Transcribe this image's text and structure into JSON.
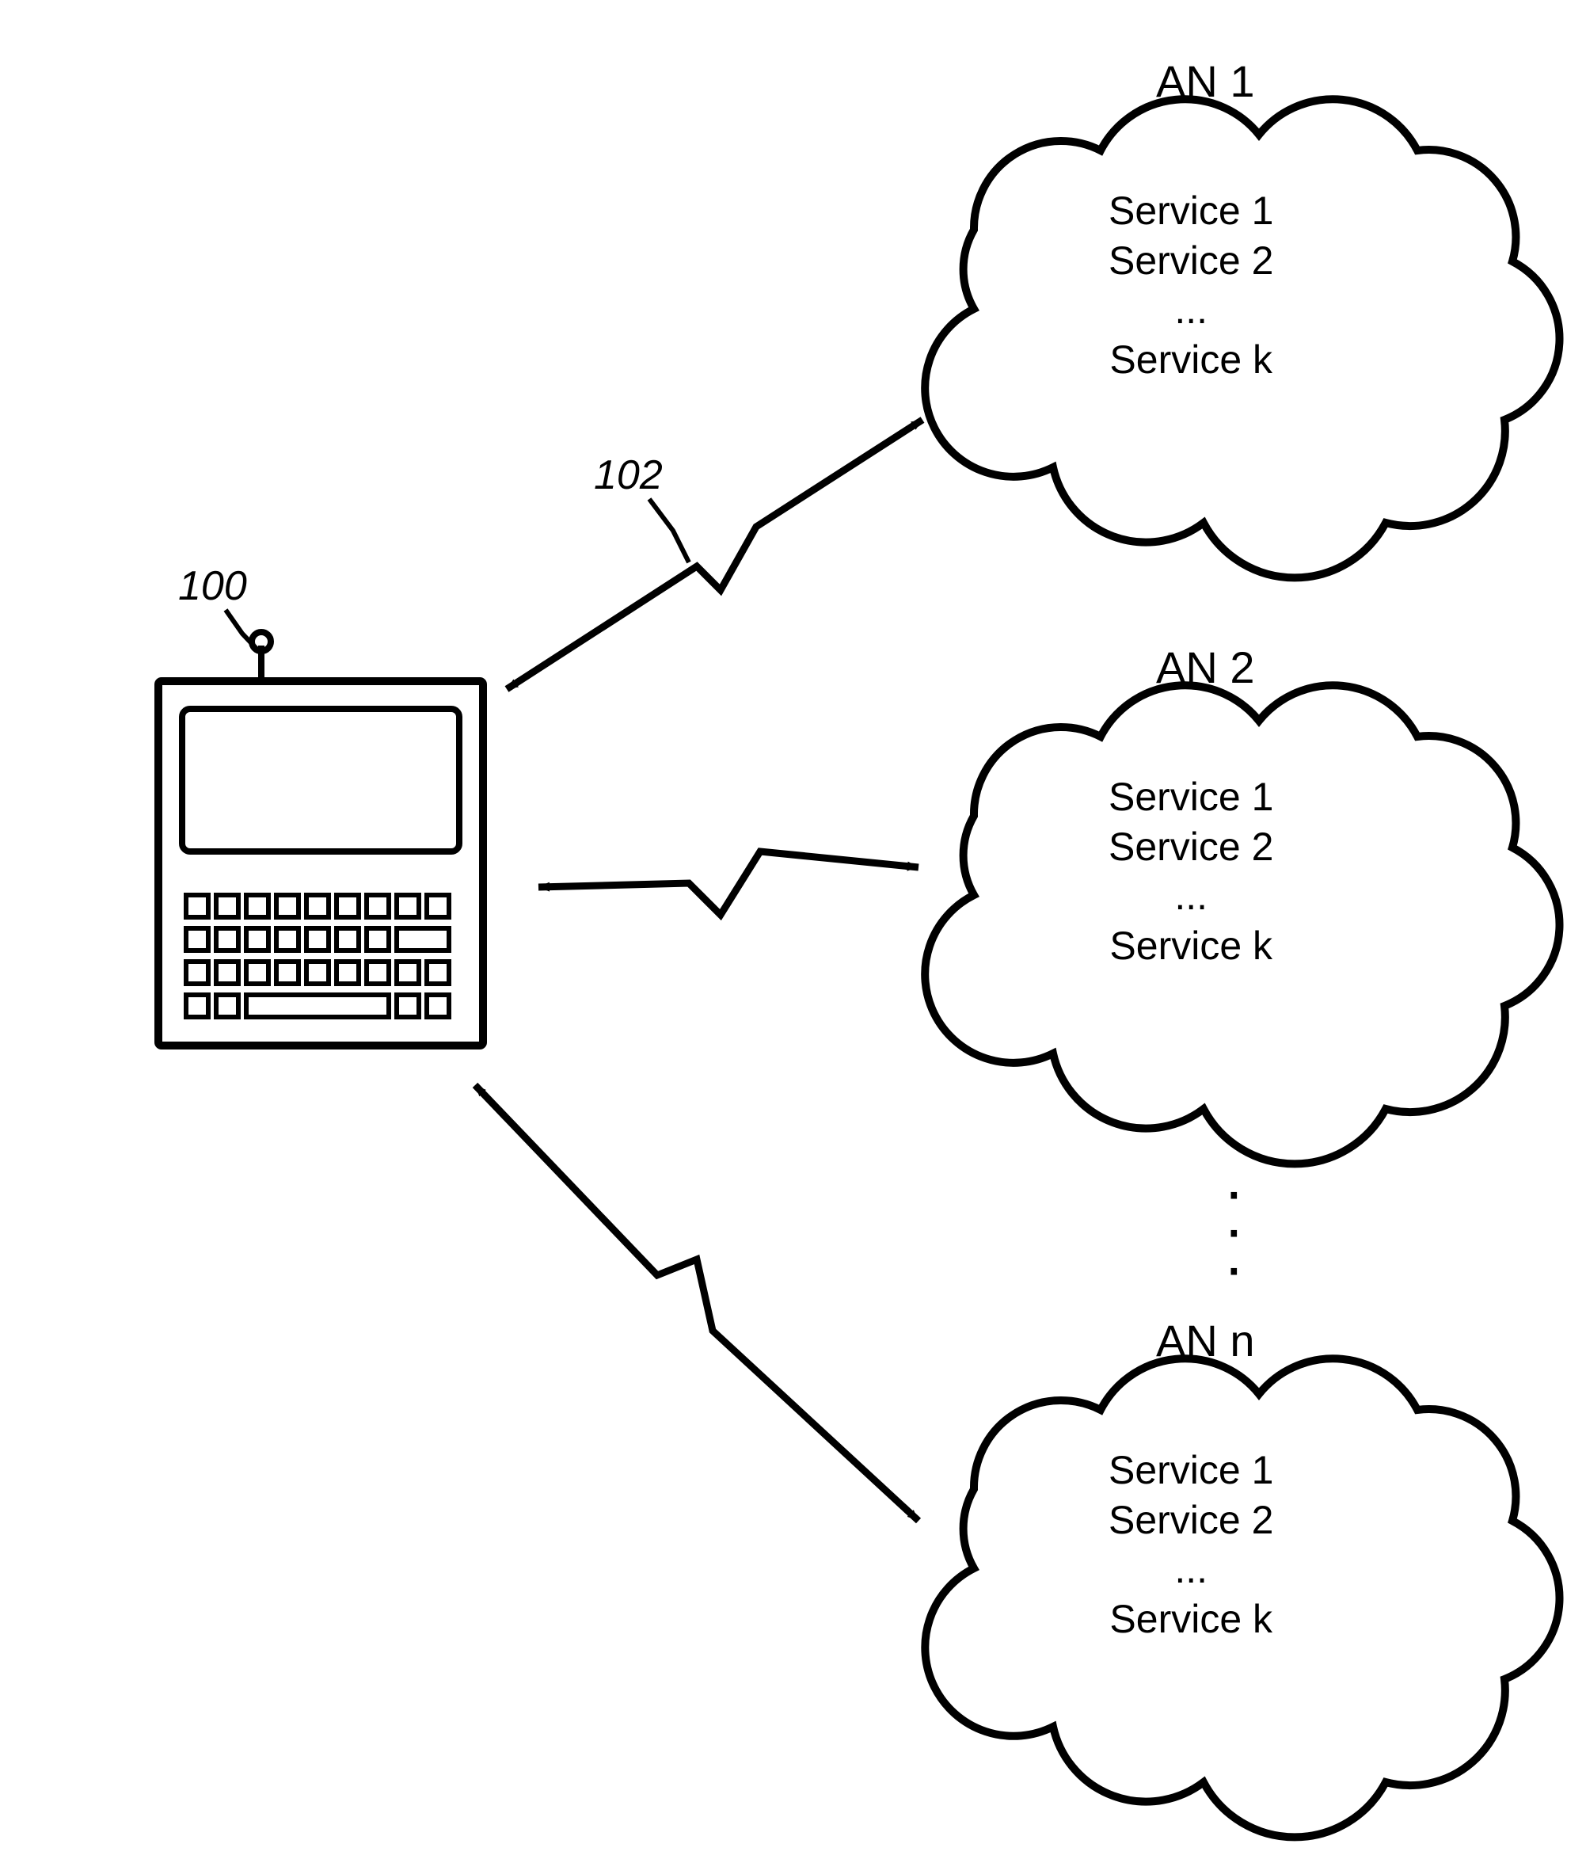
{
  "device": {
    "label_ref": "100"
  },
  "link": {
    "label_ref": "102"
  },
  "clouds": [
    {
      "title": "AN 1",
      "lines": [
        "Service 1",
        "Service 2",
        "...",
        "Service k"
      ]
    },
    {
      "title": "AN 2",
      "lines": [
        "Service 1",
        "Service 2",
        "...",
        "Service k"
      ]
    },
    {
      "title": "AN n",
      "lines": [
        "Service 1",
        "Service 2",
        "...",
        "Service k"
      ]
    }
  ],
  "ellipsis": "⋮"
}
